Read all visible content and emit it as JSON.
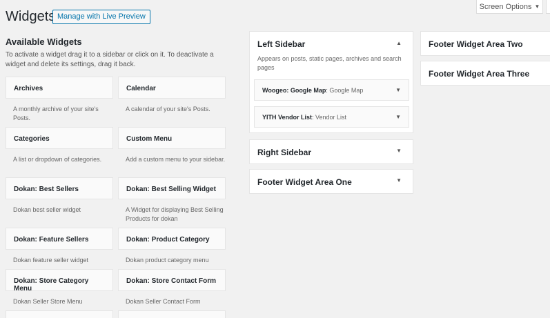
{
  "header": {
    "title": "Widgets",
    "live_preview_label": "Manage with Live Preview",
    "screen_options_label": "Screen Options"
  },
  "available": {
    "title": "Available Widgets",
    "description": "To activate a widget drag it to a sidebar or click on it. To deactivate a widget and delete its settings, drag it back.",
    "widgets": [
      {
        "name": "Archives",
        "desc": "A monthly archive of your site's Posts."
      },
      {
        "name": "Calendar",
        "desc": "A calendar of your site's Posts."
      },
      {
        "name": "Categories",
        "desc": "A list or dropdown of categories."
      },
      {
        "name": "Custom Menu",
        "desc": "Add a custom menu to your sidebar."
      },
      {
        "name": "Dokan: Best Sellers",
        "desc": "Dokan best seller widget"
      },
      {
        "name": "Dokan: Best Selling Widget",
        "desc": "A Widget for displaying Best Selling Products for dokan"
      },
      {
        "name": "Dokan: Feature Sellers",
        "desc": "Dokan feature seller widget"
      },
      {
        "name": "Dokan: Product Category",
        "desc": "Dokan product category menu"
      },
      {
        "name": "Dokan: Store Category Menu",
        "desc": "Dokan Seller Store Menu"
      },
      {
        "name": "Dokan: Store Contact Form",
        "desc": "Dokan Seller Contact Form"
      }
    ]
  },
  "sidebars": {
    "left": {
      "title": "Left Sidebar",
      "description": "Appears on posts, static pages, archives and search pages",
      "widgets": [
        {
          "name": "Woogeo: Google Map",
          "type": "Google Map"
        },
        {
          "name": "YITH Vendor List",
          "type": "Vendor List"
        }
      ]
    },
    "right": {
      "title": "Right Sidebar"
    },
    "footer_one": {
      "title": "Footer Widget Area One"
    },
    "footer_two": {
      "title": "Footer Widget Area Two"
    },
    "footer_three": {
      "title": "Footer Widget Area Three"
    }
  },
  "icons": {
    "arrow_up": "▲",
    "arrow_down": "▼"
  },
  "colors": {
    "background": "#f1f1f1",
    "link": "#0073aa"
  }
}
